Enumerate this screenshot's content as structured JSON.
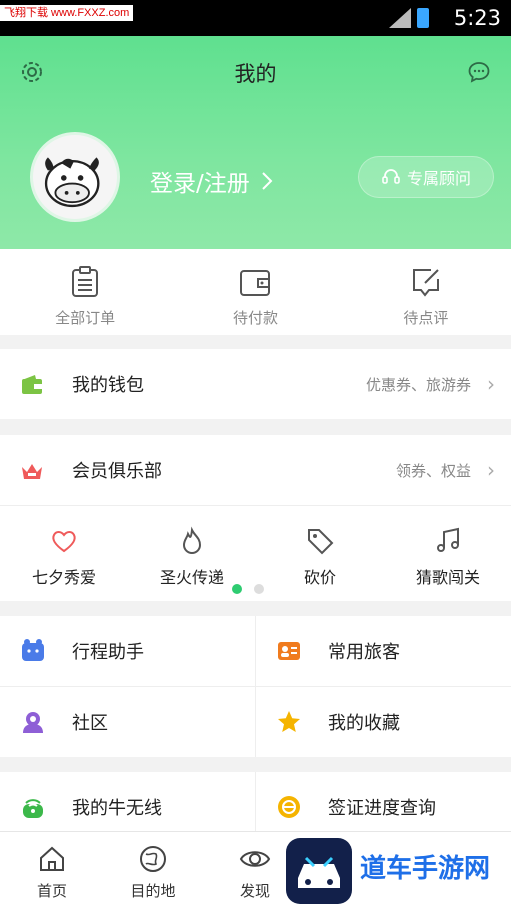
{
  "statusbar": {
    "watermark": "飞翔下载 www.FXXZ.com",
    "time": "5:23"
  },
  "header": {
    "title": "我的",
    "login": "登录/注册",
    "advisor": "专属顾问"
  },
  "orders": [
    {
      "label": "全部订单",
      "icon": "clipboard-icon"
    },
    {
      "label": "待付款",
      "icon": "wallet-icon"
    },
    {
      "label": "待点评",
      "icon": "edit-comment-icon"
    }
  ],
  "wallet": {
    "title": "我的钱包",
    "sub": "优惠券、旅游券"
  },
  "club": {
    "title": "会员俱乐部",
    "sub": "领券、权益"
  },
  "activities": [
    {
      "label": "七夕秀爱",
      "icon": "heart-icon"
    },
    {
      "label": "圣火传递",
      "icon": "flame-icon"
    },
    {
      "label": "砍价",
      "icon": "price-tag-icon"
    },
    {
      "label": "猜歌闯关",
      "icon": "music-note-icon"
    }
  ],
  "grid1": [
    {
      "label": "行程助手",
      "icon": "itinerary-icon"
    },
    {
      "label": "常用旅客",
      "icon": "traveler-card-icon"
    },
    {
      "label": "社区",
      "icon": "community-icon"
    },
    {
      "label": "我的收藏",
      "icon": "star-icon"
    }
  ],
  "grid2": [
    {
      "label": "我的牛无线",
      "icon": "wifi-icon"
    },
    {
      "label": "签证进度查询",
      "icon": "visa-icon"
    }
  ],
  "tabs": [
    {
      "label": "首页",
      "icon": "home-icon"
    },
    {
      "label": "目的地",
      "icon": "globe-icon"
    },
    {
      "label": "发现",
      "icon": "eye-icon"
    }
  ],
  "overlay": {
    "text": "道车手游网"
  },
  "colors": {
    "accent": "#2ecc71",
    "header_green": "#6ee39b",
    "orange": "#f07b1e",
    "star": "#f5b400",
    "purple": "#8e5fd6",
    "blue": "#4a7be8",
    "crown": "#ef5a5a"
  }
}
